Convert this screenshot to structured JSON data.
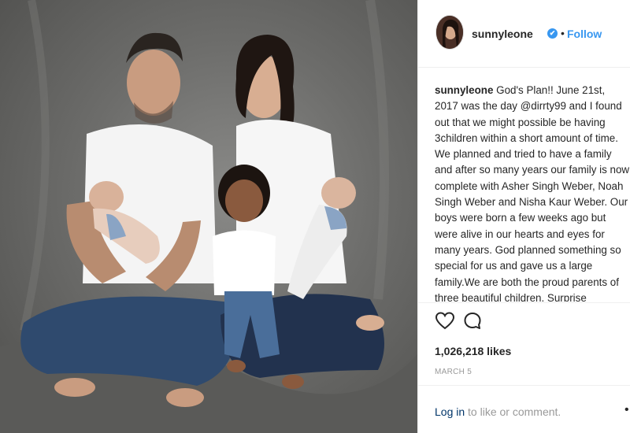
{
  "header": {
    "username": "sunnyleone",
    "verified_mark": "✔",
    "separator": "•",
    "follow_label": "Follow"
  },
  "caption": {
    "username": "sunnyleone",
    "text": "God's Plan!! June 21st, 2017 was the day @dirrty99 and I found out that we might possible be having 3children within a short amount of time. We planned and tried to have a family and after so many years our family is now complete with Asher Singh Weber, Noah Singh Weber and Nisha Kaur Weber. Our boys were born a few weeks ago but were alive in our hearts and eyes for many years. God planned something so special for us and gave us a large family.We are both the proud parents of three beautiful children. Surprise"
  },
  "actions": {
    "like_icon": "heart-icon",
    "comment_icon": "comment-icon"
  },
  "likes": "1,026,218 likes",
  "date": "MARCH 5",
  "footer": {
    "login_label": "Log in",
    "rest": " to like or comment.",
    "more_label": "•"
  },
  "colors": {
    "accent": "#3897f0",
    "text": "#262626",
    "muted": "#999999",
    "link_dark": "#003569"
  }
}
